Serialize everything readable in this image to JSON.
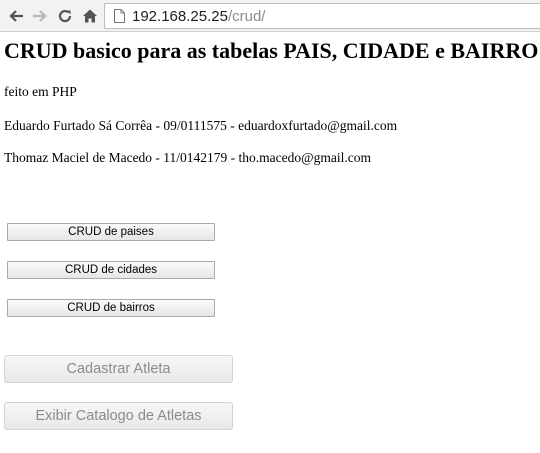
{
  "browser": {
    "url_host": "192.168.25.25",
    "url_path": "/crud/"
  },
  "page": {
    "title": "CRUD basico para as tabelas PAIS, CIDADE e BAIRRO",
    "paragraphs": [
      "feito em PHP",
      "Eduardo Furtado Sá Corrêa - 09/0111575 - eduardoxfurtado@gmail.com",
      "Thomaz Maciel de Macedo - 11/0142179 - tho.macedo@gmail.com"
    ],
    "crud_buttons": [
      "CRUD de paises",
      "CRUD de cidades",
      "CRUD de bairros"
    ],
    "action_buttons": [
      "Cadastrar Atleta",
      "Exibir Catalogo de Atletas"
    ]
  }
}
